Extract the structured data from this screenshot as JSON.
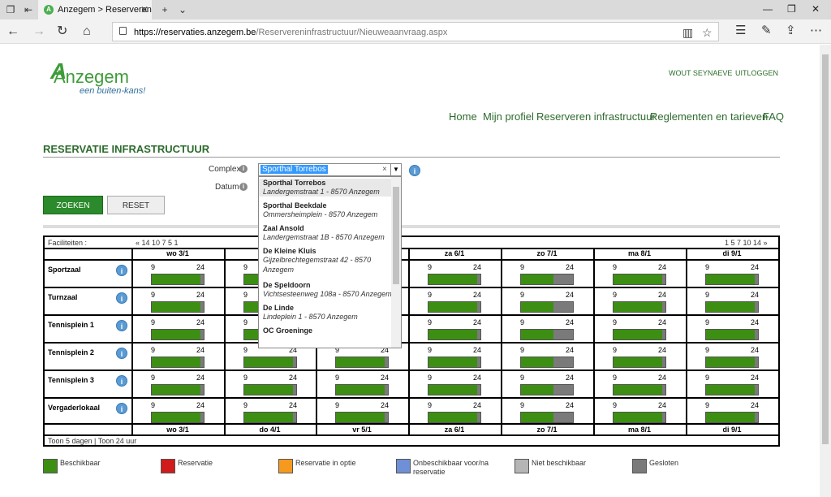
{
  "browser": {
    "tab_title": "Anzegem > Reserveren",
    "url_host": "https://reservaties.anzegem.be",
    "url_path": "/Reservereninfrastructuur/Nieuweaanvraag.aspx"
  },
  "site": {
    "logo_letters": "Anzegem",
    "tagline": "een buiten-kans!",
    "user": "WOUT SEYNAEVE",
    "logout": "UITLOGGEN"
  },
  "nav": {
    "home": "Home",
    "profile": "Mijn profiel",
    "reserve": "Reserveren infrastructuur",
    "rules": "Reglementen en tarieven",
    "faq": "FAQ"
  },
  "page_title": "RESERVATIE INFRASTRUCTUUR",
  "form": {
    "complex_label": "Complex",
    "date_label": "Datum",
    "complex_value": "Sporthal Torrebos",
    "search_button": "ZOEKEN",
    "reset_button": "RESET"
  },
  "dropdown": [
    {
      "name": "Sporthal Torrebos",
      "address": "Landergemstraat 1 - 8570 Anzegem"
    },
    {
      "name": "Sporthal Beekdale",
      "address": "Ommersheimplein - 8570 Anzegem"
    },
    {
      "name": "Zaal Ansold",
      "address": "Landergemstraat 1B - 8570 Anzegem"
    },
    {
      "name": "De Kleine Kluis",
      "address": "Gijzelbrechtegemstraat 42 - 8570 Anzegem"
    },
    {
      "name": "De Speldoorn",
      "address": "Vichtsesteenweg 108a - 8570 Anzegem"
    },
    {
      "name": "De Linde",
      "address": "Lindeplein 1 - 8570 Anzegem"
    },
    {
      "name": "OC Groeninge",
      "address": ""
    }
  ],
  "grid": {
    "facilities_header": "Faciliteiten :",
    "prev_pages": "« 14 10 7 5 1",
    "next_pages": "1 5 7 10 14 »",
    "days": [
      "wo 3/1",
      "do 4/1",
      "vr 5/1",
      "za 6/1",
      "zo 7/1",
      "ma 8/1",
      "di 9/1"
    ],
    "facilities": [
      "Sportzaal",
      "Turnzaal",
      "Tennisplein 1",
      "Tennisplein 2",
      "Tennisplein 3",
      "Vergaderlokaal"
    ],
    "start_hour": "9",
    "end_hour": "24",
    "footer": "Toon 5 dagen | Toon 24 uur"
  },
  "legend": [
    {
      "label": "Beschikbaar",
      "color": "#3d8f13"
    },
    {
      "label": "Reservatie",
      "color": "#d11a1a"
    },
    {
      "label": "Reservatie in optie",
      "color": "#f59a1e"
    },
    {
      "label": "Onbeschikbaar voor/na reservatie",
      "color": "#6f8fd6"
    },
    {
      "label": "Niet beschikbaar",
      "color": "#b5b5b5"
    },
    {
      "label": "Gesloten",
      "color": "#7a7a7a"
    }
  ]
}
